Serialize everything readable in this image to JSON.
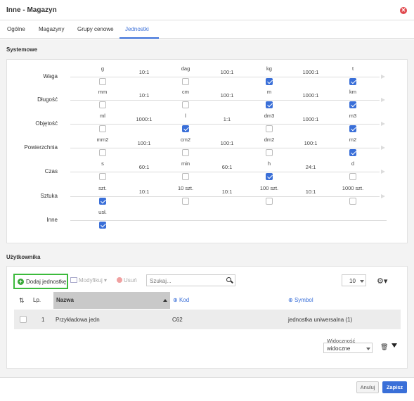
{
  "window": {
    "title": "Inne - Magazyn"
  },
  "tabs": [
    {
      "label": "Ogólne"
    },
    {
      "label": "Magazyny"
    },
    {
      "label": "Grupy cenowe"
    },
    {
      "label": "Jednostki"
    }
  ],
  "system": {
    "title": "Systemowe",
    "rows": [
      {
        "label": "Waga",
        "units": [
          {
            "name": "g",
            "checked": false
          },
          {
            "name": "dag",
            "checked": false
          },
          {
            "name": "kg",
            "checked": true
          },
          {
            "name": "t",
            "checked": true
          }
        ],
        "ratios": [
          "10:1",
          "100:1",
          "1000:1"
        ]
      },
      {
        "label": "Długość",
        "units": [
          {
            "name": "mm",
            "checked": false
          },
          {
            "name": "cm",
            "checked": false
          },
          {
            "name": "m",
            "checked": true
          },
          {
            "name": "km",
            "checked": true
          }
        ],
        "ratios": [
          "10:1",
          "100:1",
          "1000:1"
        ]
      },
      {
        "label": "Objętość",
        "units": [
          {
            "name": "ml",
            "checked": false
          },
          {
            "name": "l",
            "checked": true
          },
          {
            "name": "dm3",
            "checked": false
          },
          {
            "name": "m3",
            "checked": true
          }
        ],
        "ratios": [
          "1000:1",
          "1:1",
          "1000:1"
        ]
      },
      {
        "label": "Powierzchnia",
        "units": [
          {
            "name": "mm2",
            "checked": false
          },
          {
            "name": "cm2",
            "checked": false
          },
          {
            "name": "dm2",
            "checked": false
          },
          {
            "name": "m2",
            "checked": true
          }
        ],
        "ratios": [
          "100:1",
          "100:1",
          "100:1"
        ]
      },
      {
        "label": "Czas",
        "units": [
          {
            "name": "s",
            "checked": false
          },
          {
            "name": "min",
            "checked": false
          },
          {
            "name": "h",
            "checked": true
          },
          {
            "name": "d",
            "checked": false
          }
        ],
        "ratios": [
          "60:1",
          "60:1",
          "24:1"
        ]
      },
      {
        "label": "Sztuka",
        "units": [
          {
            "name": "szt.",
            "checked": true
          },
          {
            "name": "10 szt.",
            "checked": false
          },
          {
            "name": "100 szt.",
            "checked": false
          },
          {
            "name": "1000 szt.",
            "checked": false
          }
        ],
        "ratios": [
          "10:1",
          "10:1",
          "10:1"
        ]
      },
      {
        "label": "Inne",
        "units": [
          {
            "name": "usł.",
            "checked": true
          }
        ],
        "ratios": []
      }
    ]
  },
  "user": {
    "title": "Użytkownika",
    "toolbar": {
      "add_label": "Dodaj jednostkę",
      "modify_label": "Modyfikuj",
      "delete_label": "Usuń",
      "search_placeholder": "Szukaj...",
      "page_size": "10"
    },
    "table": {
      "headers": {
        "lp": "Lp.",
        "name": "Nazwa",
        "code": "Kod",
        "symbol": "Symbol"
      },
      "rows": [
        {
          "lp": "1",
          "name": "Przykładowa jedn",
          "code": "C62",
          "symbol": "jednostka uniwersalna (1)"
        }
      ]
    },
    "filter": {
      "label": "Widoczność",
      "value": "widoczne"
    }
  },
  "footer": {
    "cancel_label": "Anuluj",
    "save_label": "Zapisz"
  },
  "colors": {
    "accent": "#3a6fd8",
    "highlight": "#3cba3c",
    "close": "#e0474c"
  }
}
